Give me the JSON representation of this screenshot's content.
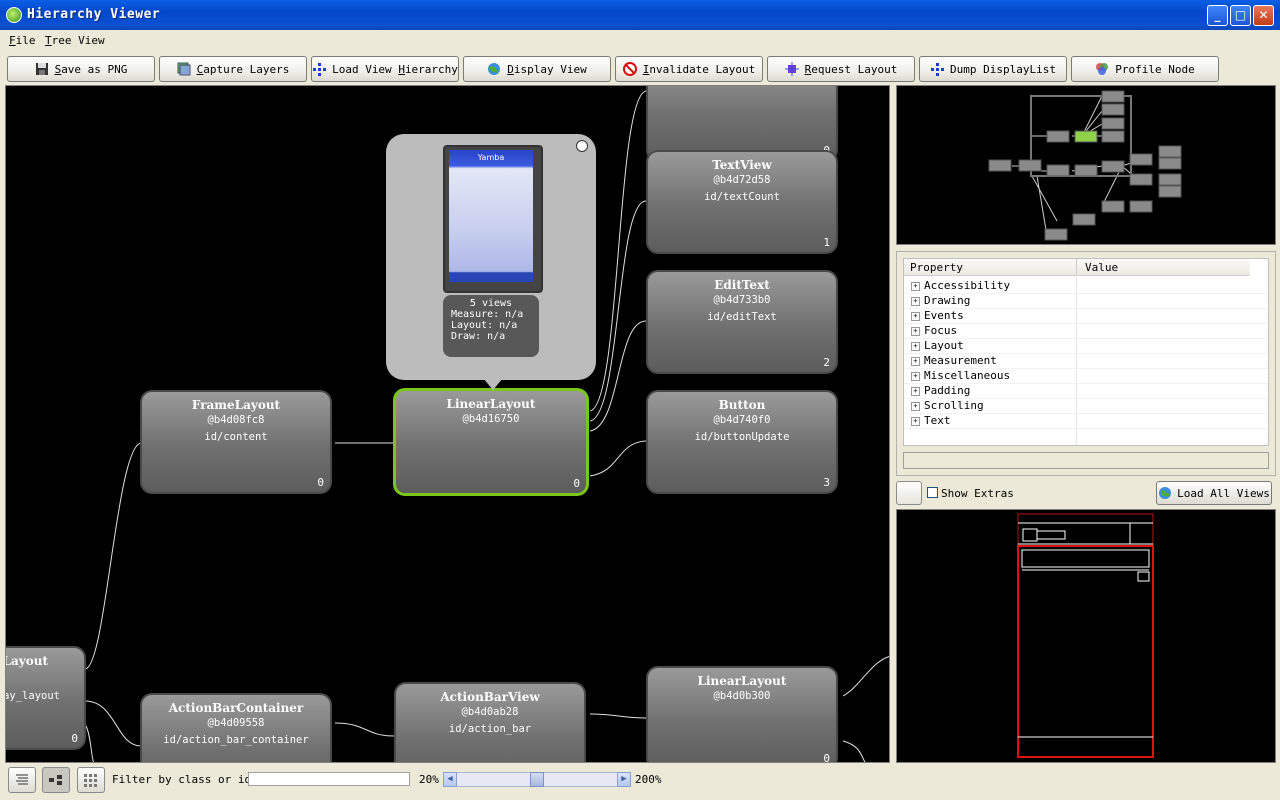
{
  "window": {
    "title": "Hierarchy Viewer"
  },
  "menu": [
    {
      "label": "File",
      "mnemonic": "F",
      "rest": "ile"
    },
    {
      "label": "Tree View",
      "mnemonic": "T",
      "rest": "ree View"
    }
  ],
  "toolbar": [
    {
      "name": "save-as-png-button",
      "icon": "floppy-disk-icon",
      "mn": "S",
      "rest": "ave as PNG"
    },
    {
      "name": "capture-layers-button",
      "icon": "layers-icon",
      "mn": "C",
      "rest": "apture Layers"
    },
    {
      "name": "load-view-hierarchy-button",
      "icon": "tree-icon",
      "pre": "Load View ",
      "mn": "H",
      "rest": "ierarchy"
    },
    {
      "name": "display-view-button",
      "icon": "globe-icon",
      "mn": "D",
      "rest": "isplay View"
    },
    {
      "name": "invalidate-layout-button",
      "icon": "no-entry-icon",
      "mn": "I",
      "rest": "nvalidate Layout"
    },
    {
      "name": "request-layout-button",
      "icon": "crosshair-icon",
      "mn": "R",
      "rest": "equest Layout"
    },
    {
      "name": "dump-displaylist-button",
      "icon": "tree-icon",
      "pre": "Dump DisplayList",
      "mn": "",
      "rest": ""
    },
    {
      "name": "profile-node-button",
      "icon": "venn-icon",
      "pre": "Profile Node",
      "mn": "",
      "rest": ""
    }
  ],
  "nodes": [
    {
      "key": "top",
      "class": "",
      "hash": "",
      "id": "",
      "index": "0"
    },
    {
      "key": "textview",
      "class": "TextView",
      "hash": "@b4d72d58",
      "id": "id/textCount",
      "index": "1"
    },
    {
      "key": "edittext",
      "class": "EditText",
      "hash": "@b4d733b0",
      "id": "id/editText",
      "index": "2"
    },
    {
      "key": "button",
      "class": "Button",
      "hash": "@b4d740f0",
      "id": "id/buttonUpdate",
      "index": "3"
    },
    {
      "key": "framelayout",
      "class": "FrameLayout",
      "hash": "@b4d08fc8",
      "id": "id/content",
      "index": "0"
    },
    {
      "key": "linearlayout-sel",
      "class": "LinearLayout",
      "hash": "@b4d16750",
      "id": "",
      "index": "0"
    },
    {
      "key": "partial-layout",
      "class": "Layout",
      "hash": "",
      "id": "ay_layout",
      "index": "0"
    },
    {
      "key": "actionbarcontainer",
      "class": "ActionBarContainer",
      "hash": "@b4d09558",
      "id": "id/action_bar_container",
      "index": ""
    },
    {
      "key": "actionbarview",
      "class": "ActionBarView",
      "hash": "@b4d0ab28",
      "id": "id/action_bar",
      "index": ""
    },
    {
      "key": "linearlayout2",
      "class": "LinearLayout",
      "hash": "@b4d0b300",
      "id": "",
      "index": "0"
    }
  ],
  "popup": {
    "app_title": "Yamba",
    "views": "5 views",
    "measure": "Measure: n/a",
    "layout": "Layout: n/a",
    "draw": "Draw: n/a"
  },
  "properties": {
    "col_property": "Property",
    "col_value": "Value",
    "rows": [
      "Accessibility",
      "Drawing",
      "Events",
      "Focus",
      "Layout",
      "Measurement",
      "Miscellaneous",
      "Padding",
      "Scrolling",
      "Text"
    ]
  },
  "extras": {
    "show_extras": "Show Extras",
    "load_all_views": "Load All Views"
  },
  "bottom": {
    "filter_label": "Filter by class or id:",
    "filter_value": "",
    "zoom_min": "20%",
    "zoom_max": "200%",
    "zoom_level": 0.5
  },
  "colors": {
    "selected": "#7cc51b",
    "overview_selected": "#8fd14a",
    "preview_outline": "#d01010"
  }
}
